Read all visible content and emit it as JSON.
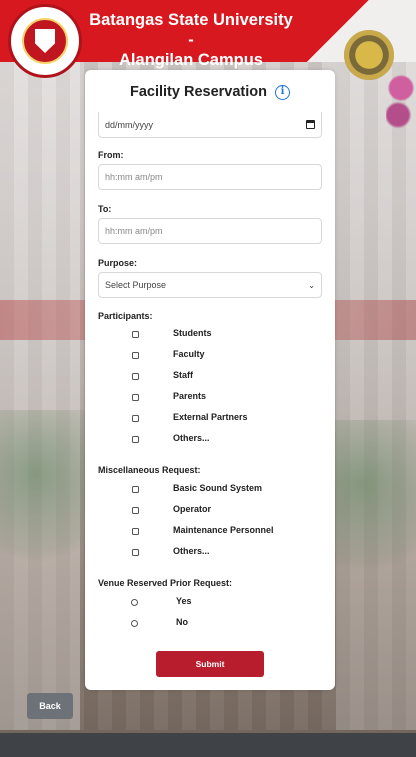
{
  "header": {
    "title_line1": "Batangas State University -",
    "title_line2": "Alangilan Campus",
    "primary_color": "#d8181f"
  },
  "form": {
    "title": "Facility Reservation",
    "date": {
      "placeholder": "dd/mm/yyyy"
    },
    "from": {
      "label": "From:",
      "placeholder": "hh:mm am/pm"
    },
    "to": {
      "label": "To:",
      "placeholder": "hh:mm am/pm"
    },
    "purpose": {
      "label": "Purpose:",
      "selected": "Select Purpose"
    },
    "participants": {
      "label": "Participants:",
      "options": [
        "Students",
        "Faculty",
        "Staff",
        "Parents",
        "External Partners",
        "Others..."
      ]
    },
    "misc": {
      "label": "Miscellaneous Request:",
      "options": [
        "Basic Sound System",
        "Operator",
        "Maintenance Personnel",
        "Others..."
      ]
    },
    "venue": {
      "label": "Venue Reserved Prior Request:",
      "options": [
        "Yes",
        "No"
      ]
    },
    "submit_label": "Submit",
    "submit_color": "#b81d2d"
  },
  "back_label": "Back"
}
